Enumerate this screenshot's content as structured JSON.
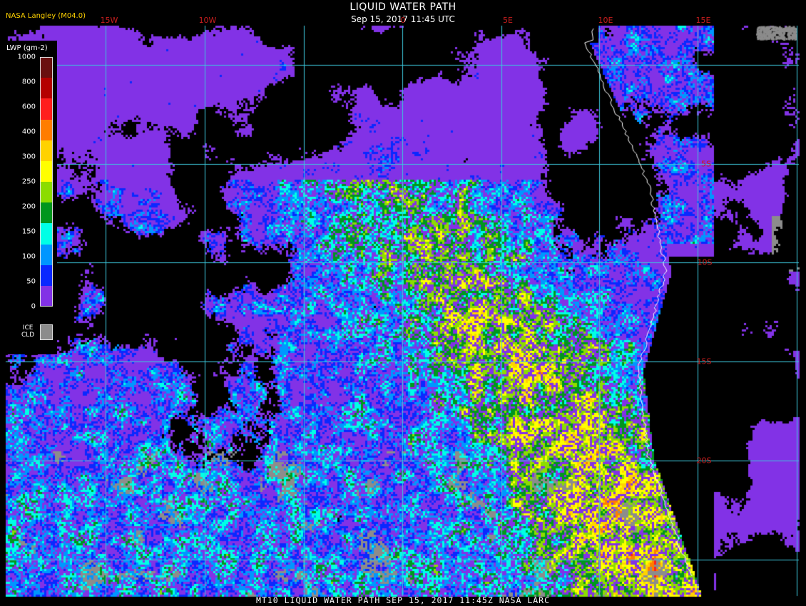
{
  "header": {
    "org": "NASA Langley (M04.0)",
    "title": "LIQUID WATER PATH",
    "subtitle": "Sep 15, 2017 11:45 UTC"
  },
  "footer": {
    "text": "MT10  LIQUID WATER PATH   SEP 15, 2017 11:45Z   NASA LARC"
  },
  "lon_labels": [
    "15W",
    "10W",
    "0",
    "5E",
    "10E",
    "15E"
  ],
  "lat_labels": [
    "5S",
    "10S",
    "15S",
    "20S"
  ],
  "legend": {
    "title": "LWP (gm-2)",
    "ticks": [
      "1000",
      "800",
      "600",
      "400",
      "300",
      "250",
      "200",
      "150",
      "100",
      "50",
      "0"
    ],
    "bins": [
      {
        "color": "#6a1010"
      },
      {
        "color": "#b40000"
      },
      {
        "color": "#ff1e1e"
      },
      {
        "color": "#ff7d00"
      },
      {
        "color": "#ffd200"
      },
      {
        "color": "#ffff00"
      },
      {
        "color": "#8cdc00"
      },
      {
        "color": "#00961e"
      },
      {
        "color": "#00ffe6"
      },
      {
        "color": "#0096ff"
      },
      {
        "color": "#0a28ff"
      },
      {
        "color": "#8232e6"
      }
    ],
    "ice_label": "ICE\nCLD",
    "ice_color": "#8c8c8c"
  },
  "colors": {
    "grid": "#3cc8dc",
    "coast": "#ffffff",
    "background": "#000000"
  }
}
